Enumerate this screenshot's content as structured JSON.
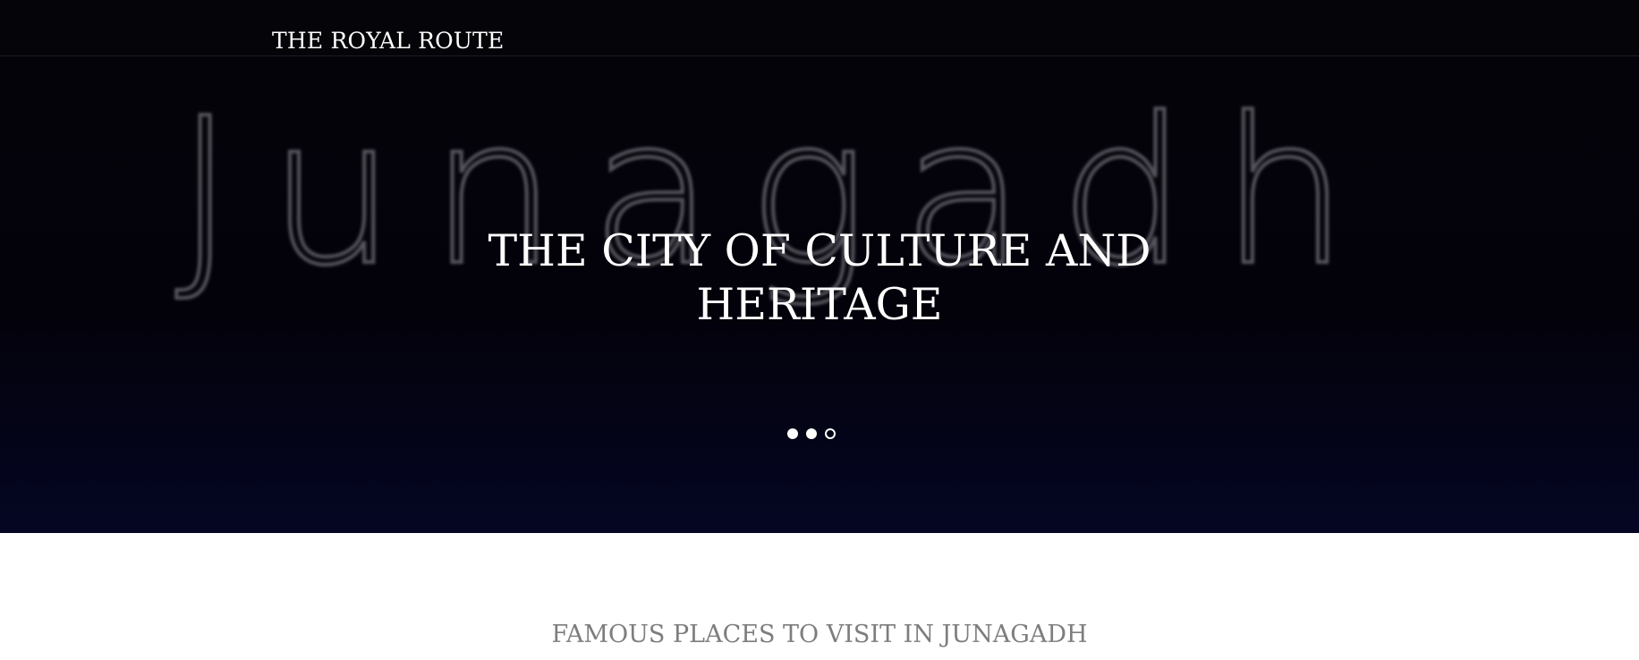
{
  "navbar": {
    "brand": "THE ROYAL ROUTE"
  },
  "hero": {
    "watermark_text": "Junagadh",
    "title": "THE CITY OF CULTURE AND HERITAGE",
    "carousel": {
      "slide_count": 3,
      "active_index": 2
    }
  },
  "colors": {
    "navbar_bg": "#050409",
    "hero_bg": "#03020b",
    "section_heading": "#7d7d7d"
  },
  "section": {
    "heading": "FAMOUS PLACES TO VISIT IN JUNAGADH"
  }
}
